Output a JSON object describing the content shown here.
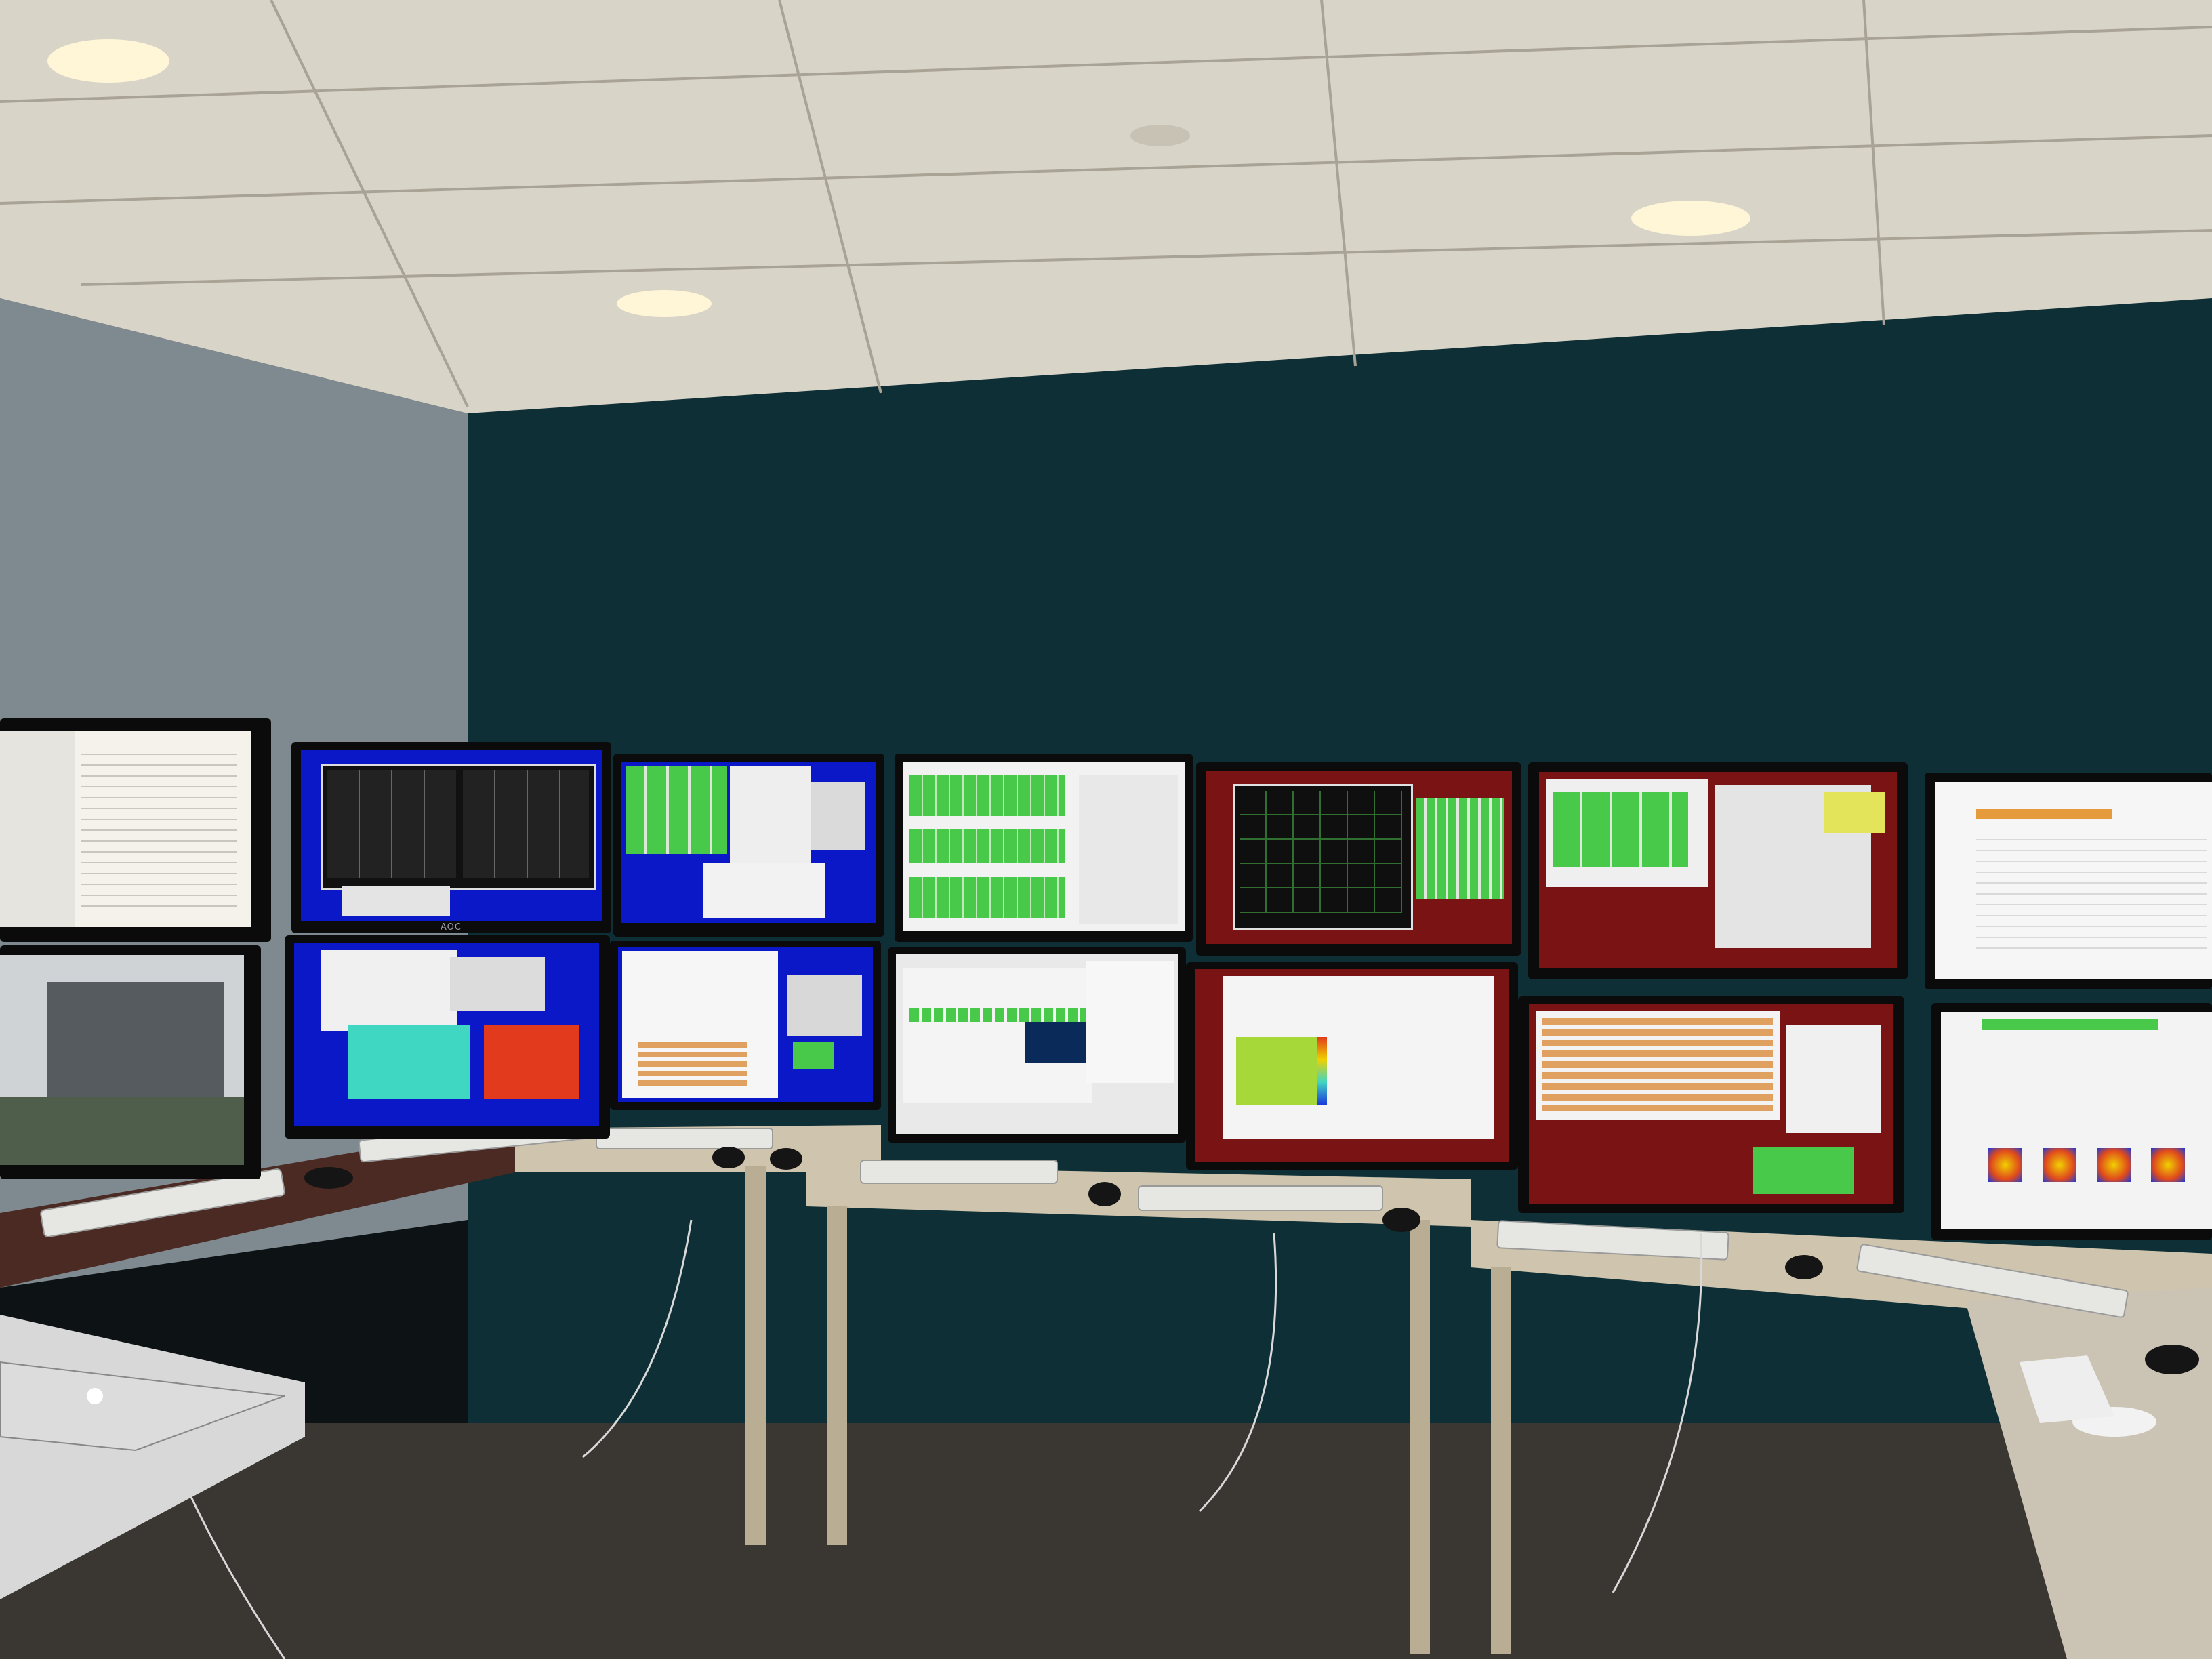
{
  "scene": {
    "description_kind": "photo",
    "monitor_brand": "AOC"
  },
  "monitors": [
    {
      "id": "m-left-top",
      "theme": "document"
    },
    {
      "id": "m-left-bottom",
      "theme": "video"
    },
    {
      "id": "m1-top",
      "theme": "blue-plots"
    },
    {
      "id": "m1-bottom",
      "theme": "blue-heatmap"
    },
    {
      "id": "m2-top",
      "theme": "blue-green-grid"
    },
    {
      "id": "m2-bottom",
      "theme": "blue-table"
    },
    {
      "id": "m3-top",
      "theme": "white-green-grid"
    },
    {
      "id": "m3-bottom",
      "theme": "white-green-panels"
    },
    {
      "id": "m4-top",
      "theme": "maroon-scope"
    },
    {
      "id": "m4-bottom",
      "theme": "maroon-heatmap"
    },
    {
      "id": "m5-top",
      "theme": "maroon-green-grid"
    },
    {
      "id": "m5-bottom",
      "theme": "maroon-table"
    },
    {
      "id": "m6-top",
      "theme": "white-app"
    },
    {
      "id": "m6-bottom",
      "theme": "white-beam-images"
    }
  ],
  "colors": {
    "wall_teal": "#0e2f36",
    "ceiling": "#e8e4da",
    "desk_top": "#cfc4ad",
    "green_status": "#49c94a",
    "blue_desktop": "#0a18c8",
    "maroon_desktop": "#7a1414"
  }
}
